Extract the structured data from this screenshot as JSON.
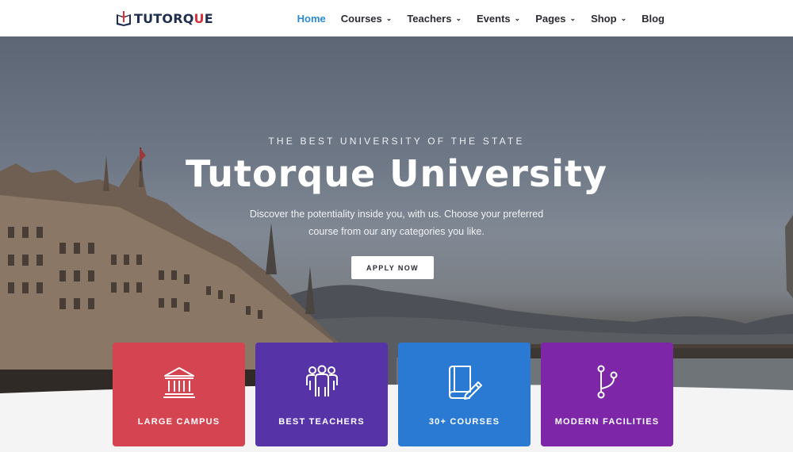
{
  "brand": {
    "name_start": "TUTORQ",
    "name_o": "U",
    "name_end": "E",
    "primary": "#1f2d4f",
    "accent": "#d8323e"
  },
  "nav": {
    "items": [
      {
        "label": "Home",
        "active": true,
        "dropdown": false
      },
      {
        "label": "Courses",
        "active": false,
        "dropdown": true
      },
      {
        "label": "Teachers",
        "active": false,
        "dropdown": true
      },
      {
        "label": "Events",
        "active": false,
        "dropdown": true
      },
      {
        "label": "Pages",
        "active": false,
        "dropdown": true
      },
      {
        "label": "Shop",
        "active": false,
        "dropdown": true
      },
      {
        "label": "Blog",
        "active": false,
        "dropdown": false
      }
    ],
    "active_color": "#2a8ad6"
  },
  "hero": {
    "eyebrow": "THE BEST UNIVERSITY OF THE STATE",
    "title": "Tutorque University",
    "description_line1": "Discover the potentiality inside you, with us. Choose your preferred",
    "description_line2": "course from our any categories  you like.",
    "cta": "APPLY NOW"
  },
  "features": [
    {
      "label": "LARGE CAMPUS",
      "icon": "building-columns-icon",
      "color": "#d44451"
    },
    {
      "label": "BEST TEACHERS",
      "icon": "users-group-icon",
      "color": "#5733a8"
    },
    {
      "label": "30+ COURSES",
      "icon": "book-pencil-icon",
      "color": "#2a7ad4"
    },
    {
      "label": "MODERN FACILITIES",
      "icon": "git-branch-icon",
      "color": "#7d27a8"
    }
  ]
}
